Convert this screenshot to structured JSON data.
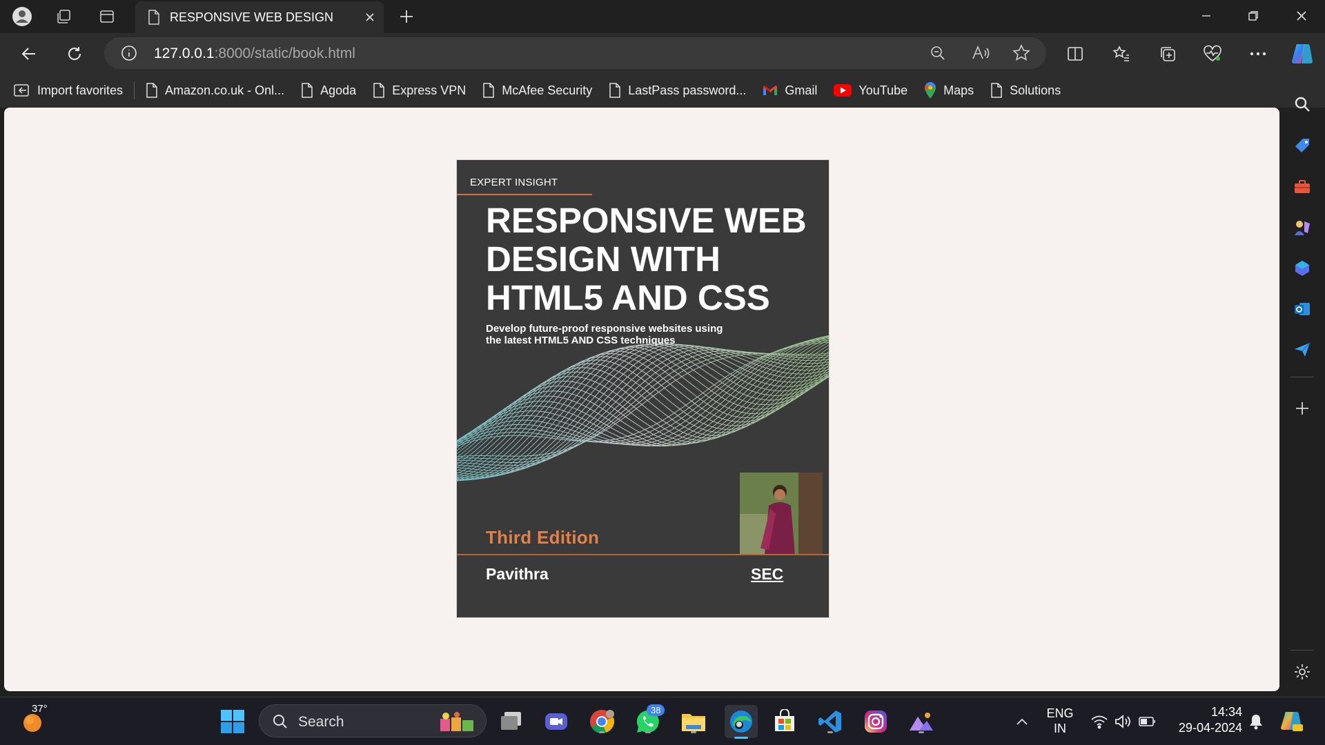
{
  "browser": {
    "tab_title": "RESPONSIVE WEB DESIGN",
    "url_host": "127.0.0.1",
    "url_rest": ":8000/static/book.html"
  },
  "bookmarks": [
    {
      "label": "Import favorites",
      "icon": "import-icon"
    },
    {
      "label": "Amazon.co.uk - Onl...",
      "icon": "page-icon"
    },
    {
      "label": "Agoda",
      "icon": "page-icon"
    },
    {
      "label": "Express VPN",
      "icon": "page-icon"
    },
    {
      "label": "McAfee Security",
      "icon": "page-icon"
    },
    {
      "label": "LastPass password...",
      "icon": "page-icon"
    },
    {
      "label": "Gmail",
      "icon": "gmail-icon"
    },
    {
      "label": "YouTube",
      "icon": "youtube-icon"
    },
    {
      "label": "Maps",
      "icon": "maps-icon"
    },
    {
      "label": "Solutions",
      "icon": "page-icon"
    }
  ],
  "cover": {
    "series": "EXPERT INSIGHT",
    "title": "RESPONSIVE WEB DESIGN WITH HTML5 AND CSS",
    "subtitle": "Develop future-proof responsive websites using the latest HTML5 AND CSS techniques",
    "edition": "Third Edition",
    "author": "Pavithra",
    "publisher": "SEC",
    "accent_color": "#e0824a"
  },
  "taskbar": {
    "weather_temp": "37°",
    "search_placeholder": "Search",
    "whatsapp_badge": "38",
    "lang_line1": "ENG",
    "lang_line2": "IN",
    "time": "14:34",
    "date": "29-04-2024"
  }
}
